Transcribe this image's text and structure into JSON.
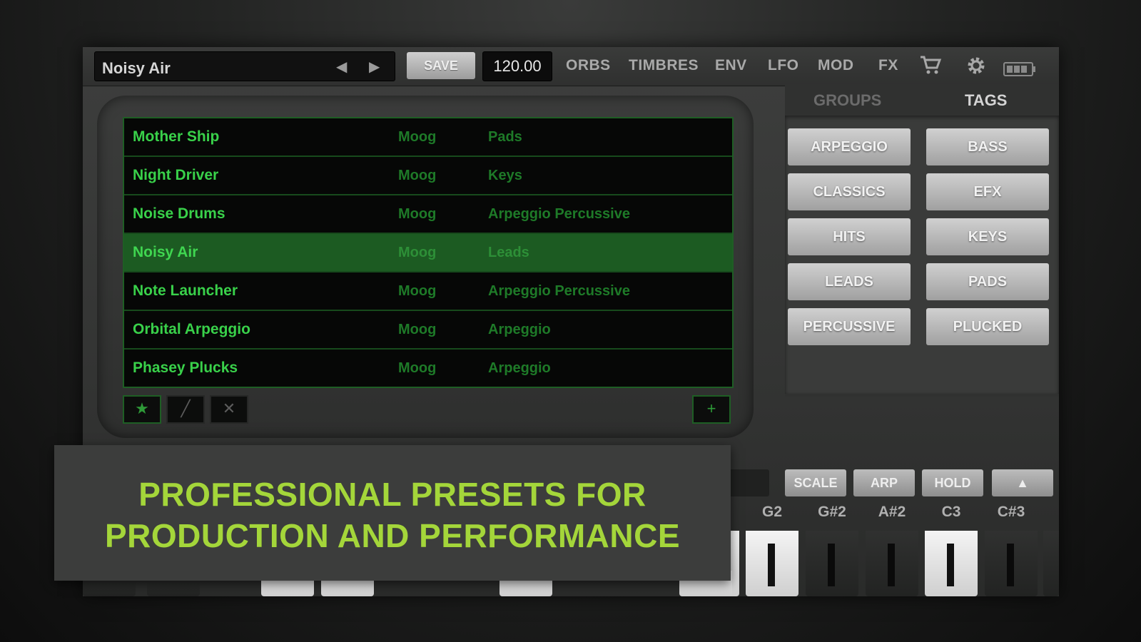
{
  "topbar": {
    "preset_name": "Noisy Air",
    "save_label": "SAVE",
    "tempo": "120.00",
    "nav": [
      "ORBS",
      "TIMBRES",
      "ENV",
      "LFO",
      "MOD",
      "FX"
    ],
    "icons": [
      "cart-icon",
      "gear-icon",
      "battery-icon"
    ]
  },
  "presets": [
    {
      "name": "Mother Ship",
      "maker": "Moog",
      "category": "Pads"
    },
    {
      "name": "Night Driver",
      "maker": "Moog",
      "category": "Keys"
    },
    {
      "name": "Noise Drums",
      "maker": "Moog",
      "category": "Arpeggio Percussive"
    },
    {
      "name": "Noisy Air",
      "maker": "Moog",
      "category": "Leads",
      "selected": true
    },
    {
      "name": "Note Launcher",
      "maker": "Moog",
      "category": "Arpeggio Percussive"
    },
    {
      "name": "Orbital Arpeggio",
      "maker": "Moog",
      "category": "Arpeggio"
    },
    {
      "name": "Phasey Plucks",
      "maker": "Moog",
      "category": "Arpeggio"
    }
  ],
  "list_actions": {
    "favorite": "★",
    "rename": "╱",
    "delete": "✕",
    "add": "+"
  },
  "tagpanel": {
    "tabs": [
      "GROUPS",
      "TAGS"
    ],
    "active_tab": "TAGS",
    "tags": [
      "ARPEGGIO",
      "BASS",
      "CLASSICS",
      "EFX",
      "HITS",
      "KEYS",
      "LEADS",
      "PADS",
      "PERCUSSIVE",
      "PLUCKED"
    ]
  },
  "keyboard": {
    "controls": [
      "SCALE",
      "ARP",
      "HOLD",
      "▲"
    ],
    "keys": [
      "G2",
      "G#2",
      "A#2",
      "C3",
      "C#3"
    ]
  },
  "caption": {
    "line1": "PROFESSIONAL PRESETS FOR",
    "line2": "PRODUCTION AND PERFORMANCE"
  },
  "colors": {
    "accent_green": "#39d14a",
    "caption_green": "#a4d63a",
    "selected_row": "#1c5b22"
  }
}
